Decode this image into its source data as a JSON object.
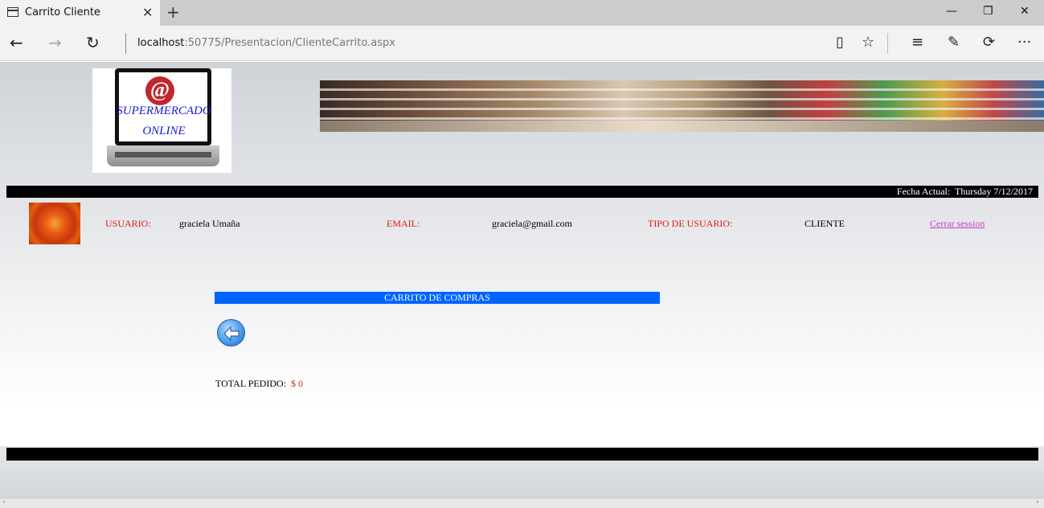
{
  "browser": {
    "tab_title": "Carrito Cliente",
    "tab_close": "✕",
    "new_tab": "+",
    "url_host": "localhost",
    "url_path": ":50775/Presentacion/ClienteCarrito.aspx",
    "window_controls": {
      "minimize": "—",
      "restore": "❐",
      "close": "✕"
    },
    "nav": {
      "back": "←",
      "forward": "→",
      "refresh": "↻"
    },
    "tools": {
      "reading_view": "▯",
      "favorite": "☆",
      "hub": "≡",
      "notes": "✎",
      "share": "⟳",
      "more": "···"
    }
  },
  "header": {
    "logo_line1": "SUPERMERCADO",
    "logo_line2": "ONLINE",
    "logo_at": "@",
    "date_label": "Fecha Actual:",
    "date_value": "Thursday 7/12/2017"
  },
  "user_info": {
    "user_label": "USUARIO:",
    "user_value": "graciela Umaña",
    "email_label": "EMAIL:",
    "email_value": "graciela@gmail.com",
    "type_label": "TIPO DE USUARIO:",
    "type_value": "CLIENTE",
    "logout": "Cerrar session"
  },
  "cart": {
    "title": "CARRITO DE COMPRAS",
    "total_label": "TOTAL PEDIDO:",
    "total_value": "$ 0"
  },
  "scrollbar": {
    "left_arrow": "‹",
    "right_arrow": "›"
  },
  "colors": {
    "accent_blue": "#0064ff",
    "label_red": "#e01b1b",
    "link_pink": "#c93bc9",
    "bar_black": "#000000"
  }
}
